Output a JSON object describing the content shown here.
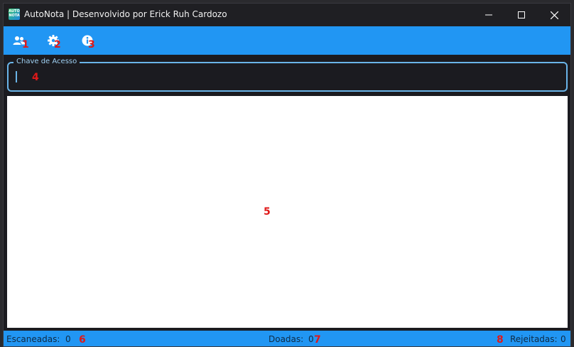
{
  "window": {
    "title": "AutoNota | Desenvolvido por Erick Ruh Cardozo",
    "icon_text": "AUTO NOTA",
    "controls": [
      "minimize",
      "maximize",
      "close"
    ]
  },
  "toolbar": {
    "buttons": [
      {
        "icon": "users-icon",
        "marker": "1"
      },
      {
        "icon": "gear-icon",
        "marker": "2"
      },
      {
        "icon": "info-icon",
        "marker": "3"
      }
    ]
  },
  "access_key": {
    "label": "Chave de Acesso",
    "value": "",
    "marker": "4"
  },
  "content": {
    "marker": "5"
  },
  "status": {
    "scanned_label": "Escaneadas:",
    "scanned_value": "0",
    "scanned_marker": "6",
    "donated_label": "Doadas:",
    "donated_value": "0",
    "donated_marker": "7",
    "rejected_marker": "8",
    "rejected_label": "Rejeitadas:",
    "rejected_value": "0"
  },
  "colors": {
    "accent": "#2196f3",
    "marker": "#e01919",
    "field_border": "#6ab4e8",
    "background": "#1b1b20"
  }
}
